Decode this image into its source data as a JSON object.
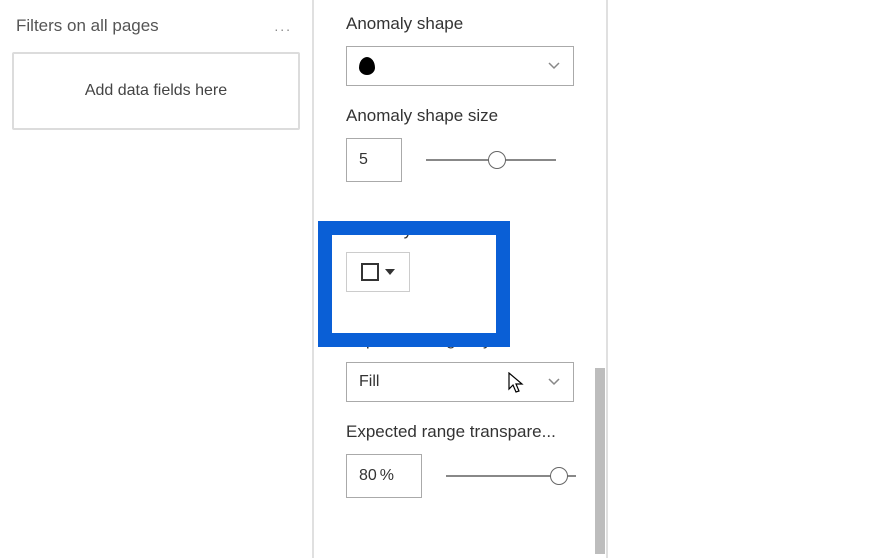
{
  "filters": {
    "title": "Filters on all pages",
    "add_placeholder": "Add data fields here"
  },
  "format": {
    "anomaly_shape": {
      "label": "Anomaly shape",
      "value_icon": "drop"
    },
    "anomaly_shape_size": {
      "label": "Anomaly shape size",
      "value": "5",
      "slider_pct": 48
    },
    "anomaly_color": {
      "label": "Anomaly color",
      "swatch": "#ffffff"
    },
    "expected_range_style": {
      "label": "Expected range style",
      "value": "Fill"
    },
    "expected_range_transparency": {
      "label": "Expected range transpare...",
      "value": "80",
      "unit": "%",
      "slider_pct": 80
    }
  }
}
